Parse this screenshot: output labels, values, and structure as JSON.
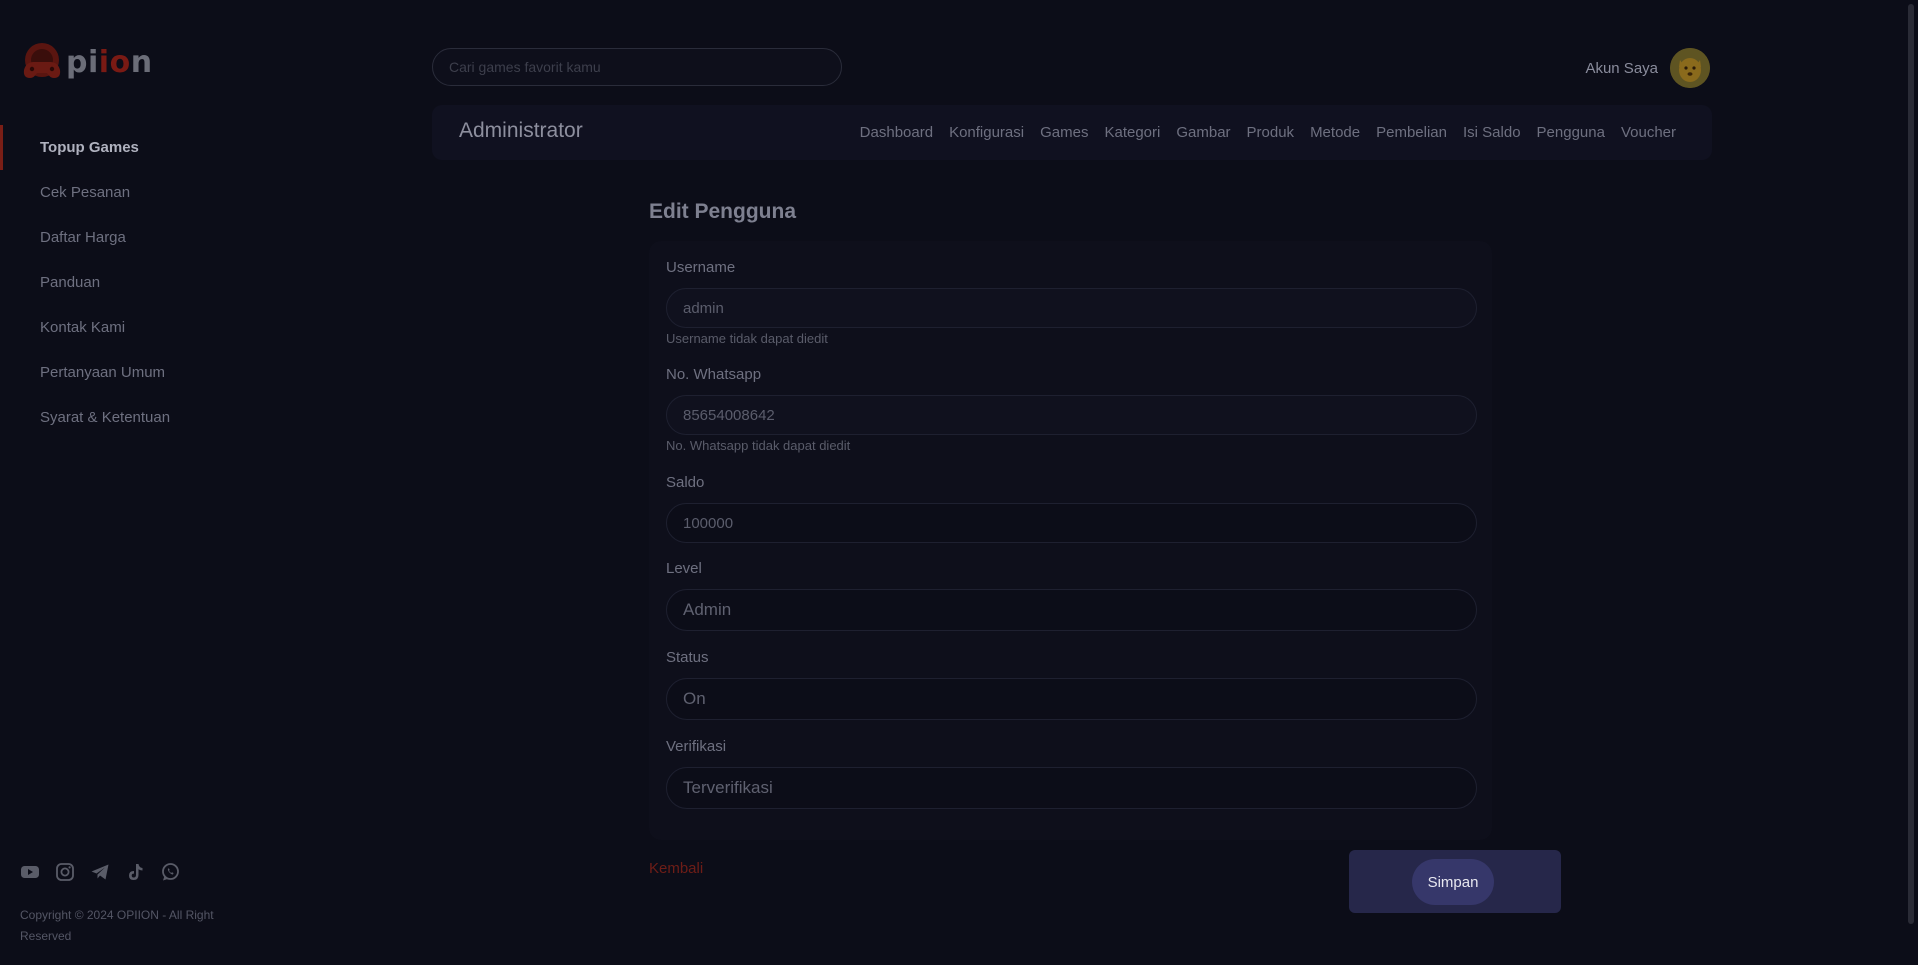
{
  "brand": {
    "logo_text_start": "p",
    "logo_text_accent": "i",
    "logo_text_mid": "i",
    "logo_text_accent2": "o",
    "logo_text_end": "n",
    "accent_color": "#7a1e16"
  },
  "sidebar": {
    "items": [
      {
        "label": "Topup Games",
        "active": true
      },
      {
        "label": "Cek Pesanan",
        "active": false
      },
      {
        "label": "Daftar Harga",
        "active": false
      },
      {
        "label": "Panduan",
        "active": false
      },
      {
        "label": "Kontak Kami",
        "active": false
      },
      {
        "label": "Pertanyaan Umum",
        "active": false
      },
      {
        "label": "Syarat & Ketentuan",
        "active": false
      }
    ],
    "socials": [
      "youtube-icon",
      "instagram-icon",
      "telegram-icon",
      "tiktok-icon",
      "whatsapp-icon"
    ],
    "copyright": "Copyright © 2024 OPIION - All Right Reserved"
  },
  "header": {
    "search_placeholder": "Cari games favorit kamu",
    "account_label": "Akun Saya"
  },
  "adminbar": {
    "title": "Administrator",
    "nav": [
      "Dashboard",
      "Konfigurasi",
      "Games",
      "Kategori",
      "Gambar",
      "Produk",
      "Metode",
      "Pembelian",
      "Isi Saldo",
      "Pengguna",
      "Voucher"
    ]
  },
  "form": {
    "title": "Edit Pengguna",
    "username_label": "Username",
    "username_value": "admin",
    "username_hint": "Username tidak dapat diedit",
    "whatsapp_label": "No. Whatsapp",
    "whatsapp_value": "85654008642",
    "whatsapp_hint": "No. Whatsapp tidak dapat diedit",
    "saldo_label": "Saldo",
    "saldo_value": "100000",
    "level_label": "Level",
    "level_value": "Admin",
    "status_label": "Status",
    "status_value": "On",
    "verifikasi_label": "Verifikasi",
    "verifikasi_value": "Terverifikasi",
    "back_label": "Kembali",
    "save_label": "Simpan"
  }
}
